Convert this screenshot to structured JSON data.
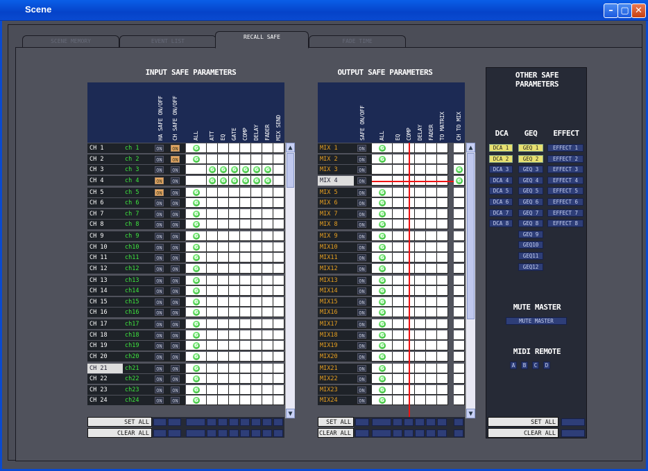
{
  "window": {
    "title": "Scene",
    "min": "–",
    "max": "▢",
    "close": "✕"
  },
  "tabs": [
    {
      "label": "SCENE MEMORY",
      "active": false
    },
    {
      "label": "EVENT LIST",
      "active": false
    },
    {
      "label": "RECALL SAFE",
      "active": true
    },
    {
      "label": "FADE TIME",
      "active": false
    }
  ],
  "input": {
    "title": "INPUT SAFE PARAMETERS",
    "columns": [
      "HA SAFE ON/OFF",
      "CH SAFE ON/OFF",
      "ALL",
      "ATT",
      "EQ",
      "GATE",
      "COMP",
      "DELAY",
      "FADER",
      "MIX SEND"
    ],
    "rows": [
      {
        "ch": "CH 1",
        "name": "ch 1",
        "ha": "ON",
        "safe": "ON",
        "ha_lit": false,
        "safe_lit": true,
        "all": true,
        "g": []
      },
      {
        "ch": "CH 2",
        "name": "ch 2",
        "ha": "ON",
        "safe": "ON",
        "ha_lit": false,
        "safe_lit": true,
        "all": true,
        "g": []
      },
      {
        "ch": "CH 3",
        "name": "ch 3",
        "ha": "ON",
        "safe": "ON",
        "ha_lit": false,
        "safe_lit": false,
        "all": false,
        "g": [
          1,
          2,
          3,
          4,
          5,
          6
        ]
      },
      {
        "ch": "CH 4",
        "name": "ch 4",
        "ha": "ON",
        "safe": "ON",
        "ha_lit": true,
        "safe_lit": false,
        "all": false,
        "g": [
          1,
          2,
          3,
          4,
          5,
          6
        ]
      },
      {
        "ch": "CH 5",
        "name": "ch 5",
        "ha": "ON",
        "safe": "ON",
        "ha_lit": true,
        "safe_lit": false,
        "all": true,
        "g": []
      },
      {
        "ch": "CH 6",
        "name": "ch 6",
        "ha": "ON",
        "safe": "ON",
        "all": true,
        "g": []
      },
      {
        "ch": "CH 7",
        "name": "ch 7",
        "ha": "ON",
        "safe": "ON",
        "all": true,
        "g": []
      },
      {
        "ch": "CH 8",
        "name": "ch 8",
        "ha": "ON",
        "safe": "ON",
        "all": true,
        "g": []
      },
      {
        "ch": "CH 9",
        "name": "ch 9",
        "ha": "ON",
        "safe": "ON",
        "all": true,
        "g": []
      },
      {
        "ch": "CH 10",
        "name": "ch10",
        "ha": "ON",
        "safe": "ON",
        "all": true,
        "g": []
      },
      {
        "ch": "CH 11",
        "name": "ch11",
        "ha": "ON",
        "safe": "ON",
        "all": true,
        "g": []
      },
      {
        "ch": "CH 12",
        "name": "ch12",
        "ha": "ON",
        "safe": "ON",
        "all": true,
        "g": []
      },
      {
        "ch": "CH 13",
        "name": "ch13",
        "ha": "ON",
        "safe": "ON",
        "all": true,
        "g": []
      },
      {
        "ch": "CH 14",
        "name": "ch14",
        "ha": "ON",
        "safe": "ON",
        "all": true,
        "g": []
      },
      {
        "ch": "CH 15",
        "name": "ch15",
        "ha": "ON",
        "safe": "ON",
        "all": true,
        "g": []
      },
      {
        "ch": "CH 16",
        "name": "ch16",
        "ha": "ON",
        "safe": "ON",
        "all": true,
        "g": []
      },
      {
        "ch": "CH 17",
        "name": "ch17",
        "ha": "ON",
        "safe": "ON",
        "all": true,
        "g": []
      },
      {
        "ch": "CH 18",
        "name": "ch18",
        "ha": "ON",
        "safe": "ON",
        "all": true,
        "g": []
      },
      {
        "ch": "CH 19",
        "name": "ch19",
        "ha": "ON",
        "safe": "ON",
        "all": true,
        "g": []
      },
      {
        "ch": "CH 20",
        "name": "ch20",
        "ha": "ON",
        "safe": "ON",
        "all": true,
        "g": []
      },
      {
        "ch": "CH 21",
        "name": "ch21",
        "ha": "ON",
        "safe": "ON",
        "all": true,
        "g": [],
        "selected": true
      },
      {
        "ch": "CH 22",
        "name": "ch22",
        "ha": "ON",
        "safe": "ON",
        "all": true,
        "g": []
      },
      {
        "ch": "CH 23",
        "name": "ch23",
        "ha": "ON",
        "safe": "ON",
        "all": true,
        "g": []
      },
      {
        "ch": "CH 24",
        "name": "ch24",
        "ha": "ON",
        "safe": "ON",
        "all": true,
        "g": []
      }
    ],
    "set_all": "SET ALL",
    "clear_all": "CLEAR ALL"
  },
  "output": {
    "title": "OUTPUT SAFE PARAMETERS",
    "columns": [
      "SAFE ON/OFF",
      "ALL",
      "EQ",
      "COMP",
      "DELAY",
      "FADER",
      "TO MATRIX",
      "CH TO MIX"
    ],
    "rows": [
      {
        "mix": "MIX 1",
        "on": "ON",
        "all": true,
        "tomix": false
      },
      {
        "mix": "MIX 2",
        "on": "ON",
        "all": true,
        "tomix": false
      },
      {
        "mix": "MIX 3",
        "on": "ON",
        "all": false,
        "tomix": true
      },
      {
        "mix": "MIX 4",
        "on": "ON",
        "all": false,
        "tomix": true,
        "selected": true
      },
      {
        "mix": "MIX 5",
        "on": "ON",
        "all": true
      },
      {
        "mix": "MIX 6",
        "on": "ON",
        "all": true
      },
      {
        "mix": "MIX 7",
        "on": "ON",
        "all": true
      },
      {
        "mix": "MIX 8",
        "on": "ON",
        "all": true
      },
      {
        "mix": "MIX 9",
        "on": "ON",
        "all": true
      },
      {
        "mix": "MIX10",
        "on": "ON",
        "all": true
      },
      {
        "mix": "MIX11",
        "on": "ON",
        "all": true
      },
      {
        "mix": "MIX12",
        "on": "ON",
        "all": true
      },
      {
        "mix": "MIX13",
        "on": "ON",
        "all": true
      },
      {
        "mix": "MIX14",
        "on": "ON",
        "all": true
      },
      {
        "mix": "MIX15",
        "on": "ON",
        "all": true
      },
      {
        "mix": "MIX16",
        "on": "ON",
        "all": true
      },
      {
        "mix": "MIX17",
        "on": "ON",
        "all": true
      },
      {
        "mix": "MIX18",
        "on": "ON",
        "all": true
      },
      {
        "mix": "MIX19",
        "on": "ON",
        "all": true
      },
      {
        "mix": "MIX20",
        "on": "ON",
        "all": true
      },
      {
        "mix": "MIX21",
        "on": "ON",
        "all": true
      },
      {
        "mix": "MIX22",
        "on": "ON",
        "all": true
      },
      {
        "mix": "MIX23",
        "on": "ON",
        "all": true
      },
      {
        "mix": "MIX24",
        "on": "ON",
        "all": true
      }
    ],
    "set_all": "SET ALL",
    "clear_all": "CLEAR ALL"
  },
  "other": {
    "title1": "OTHER SAFE",
    "title2": "PARAMETERS",
    "dca_h": "DCA",
    "geq_h": "GEQ",
    "effect_h": "EFFECT",
    "dca": [
      {
        "l": "DCA 1",
        "lit": true
      },
      {
        "l": "DCA 2",
        "lit": true
      },
      {
        "l": "DCA 3"
      },
      {
        "l": "DCA 4"
      },
      {
        "l": "DCA 5"
      },
      {
        "l": "DCA 6"
      },
      {
        "l": "DCA 7"
      },
      {
        "l": "DCA 8"
      }
    ],
    "geq": [
      {
        "l": "GEQ 1",
        "lit": true
      },
      {
        "l": "GEQ 2",
        "lit": true
      },
      {
        "l": "GEQ 3"
      },
      {
        "l": "GEQ 4"
      },
      {
        "l": "GEQ 5"
      },
      {
        "l": "GEQ 6"
      },
      {
        "l": "GEQ 7"
      },
      {
        "l": "GEQ 8"
      },
      {
        "l": "GEQ 9"
      },
      {
        "l": "GEQ10"
      },
      {
        "l": "GEQ11"
      },
      {
        "l": "GEQ12"
      }
    ],
    "effect": [
      {
        "l": "EFFECT 1"
      },
      {
        "l": "EFFECT 2"
      },
      {
        "l": "EFFECT 3"
      },
      {
        "l": "EFFECT 4"
      },
      {
        "l": "EFFECT 5"
      },
      {
        "l": "EFFECT 6"
      },
      {
        "l": "EFFECT 7"
      },
      {
        "l": "EFFECT 8"
      }
    ],
    "mute_title": "MUTE MASTER",
    "mute_btn": "MUTE MASTER",
    "midi_title": "MIDI REMOTE",
    "midi": [
      "A",
      "B",
      "C",
      "D"
    ],
    "set_all": "SET ALL",
    "clear_all": "CLEAR ALL"
  },
  "icons": {
    "green_button": "G",
    "scroll_up": "▲",
    "scroll_down": "▼"
  },
  "colors": {
    "accent_on": "#e8a860",
    "dca_lit": "#e8e070",
    "channel_name": "#3ee83e",
    "mix_name": "#e8a020",
    "safe_line": "#ee1111",
    "title_bar": "#0543c9"
  }
}
